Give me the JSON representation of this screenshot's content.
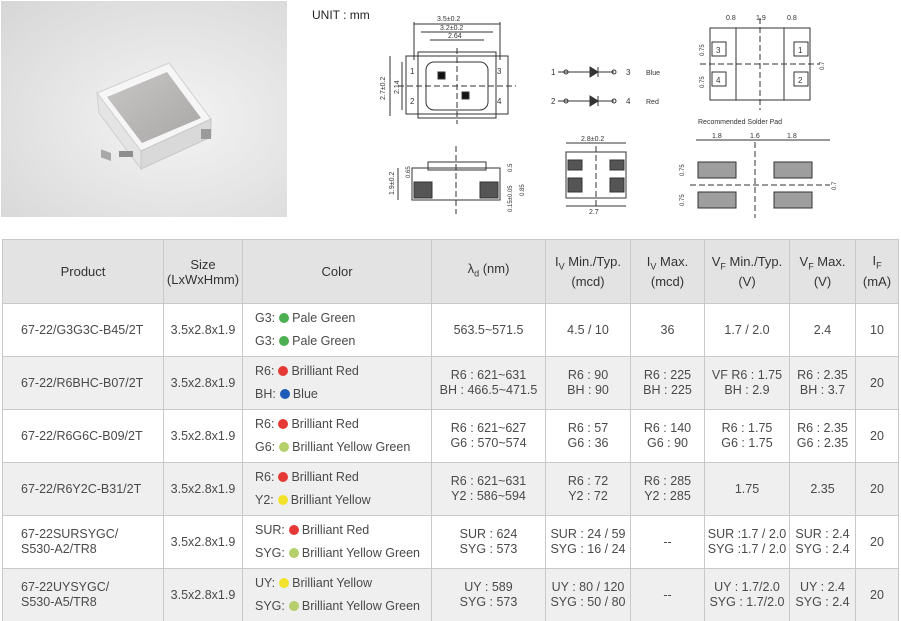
{
  "unit_label": "UNIT : mm",
  "drawing": {
    "top_dims": [
      "3.5±0.2",
      "3.2±0.2",
      "2.64"
    ],
    "left_dims": [
      "2.7±0.2",
      "2.14"
    ],
    "pad_numbers": [
      "1",
      "2",
      "3",
      "4"
    ],
    "circuit": {
      "row1": {
        "start": "1",
        "end": "3",
        "color": "Blue"
      },
      "row2": {
        "start": "2",
        "end": "4",
        "color": "Red"
      }
    },
    "side_dims": [
      "1.9±0.2",
      "0.65",
      "0.5",
      "0.15±0.05",
      "0.85"
    ],
    "front_dims": [
      "2.8±0.2",
      "2.7"
    ],
    "pad_top_dims": [
      "0.8",
      "1.9",
      "0.8"
    ],
    "pad_side_dims": [
      "0.75",
      "0.75",
      "0.7"
    ],
    "solder_title": "Recommended Solder Pad",
    "solder_dims": [
      "1.8",
      "1.6",
      "1.8"
    ],
    "solder_side_dims": [
      "0.75",
      "0.75",
      "0.7"
    ]
  },
  "table": {
    "headers": {
      "product": "Product",
      "size": "Size",
      "size_unit": "(LxWxHmm)",
      "color": "Color",
      "wavelength_symbol": "λ",
      "wavelength_sub": "d",
      "wavelength_unit": " (nm)",
      "iv_min_symbol": "I",
      "iv_min_sub": "V",
      "iv_min_label": " Min./Typ.",
      "iv_min_unit": "(mcd)",
      "iv_max_symbol": "I",
      "iv_max_sub": "V",
      "iv_max_label": " Max.",
      "iv_max_unit": "(mcd)",
      "vf_min_symbol": "V",
      "vf_min_sub": "F",
      "vf_min_label": " Min./Typ.",
      "vf_min_unit": "(V)",
      "vf_max_symbol": "V",
      "vf_max_sub": "F",
      "vf_max_label": " Max.",
      "vf_max_unit": "(V)",
      "if_symbol": "I",
      "if_sub": "F",
      "if_unit": " (mA)"
    },
    "rows": [
      {
        "product": [
          "67-22/G3G3C-B45/2T"
        ],
        "size": "3.5x2.8x1.9",
        "colors": [
          {
            "code": "G3:",
            "dot": "#4caf50",
            "name": "Pale Green"
          },
          {
            "code": "G3:",
            "dot": "#4caf50",
            "name": "Pale Green"
          }
        ],
        "wavelength": [
          "563.5~571.5"
        ],
        "iv_min_typ": [
          "4.5 / 10"
        ],
        "iv_max": [
          "36"
        ],
        "vf_min_typ": [
          "1.7 / 2.0"
        ],
        "vf_max": [
          "2.4"
        ],
        "if": "10"
      },
      {
        "product": [
          "67-22/R6BHC-B07/2T"
        ],
        "size": "3.5x2.8x1.9",
        "colors": [
          {
            "code": "R6:",
            "dot": "#e53935",
            "name": "Brilliant Red"
          },
          {
            "code": "BH:",
            "dot": "#1e5bb8",
            "name": "Blue"
          }
        ],
        "wavelength": [
          "R6 : 621~631",
          "BH : 466.5~471.5"
        ],
        "iv_min_typ": [
          "R6 : 90",
          "BH : 90"
        ],
        "iv_max": [
          "R6 : 225",
          "BH : 225"
        ],
        "vf_min_typ": [
          "VF R6 : 1.75",
          "BH : 2.9"
        ],
        "vf_max": [
          "R6 : 2.35",
          "BH : 3.7"
        ],
        "if": "20"
      },
      {
        "product": [
          "67-22/R6G6C-B09/2T"
        ],
        "size": "3.5x2.8x1.9",
        "colors": [
          {
            "code": "R6:",
            "dot": "#e53935",
            "name": "Brilliant Red"
          },
          {
            "code": "G6:",
            "dot": "#b5cf6b",
            "name": "Brilliant Yellow Green"
          }
        ],
        "wavelength": [
          "R6 : 621~627",
          "G6 : 570~574"
        ],
        "iv_min_typ": [
          "R6 : 57",
          "G6 : 36"
        ],
        "iv_max": [
          "R6 : 140",
          "G6 : 90"
        ],
        "vf_min_typ": [
          "R6 : 1.75",
          "G6 : 1.75"
        ],
        "vf_max": [
          "R6 : 2.35",
          "G6 : 2.35"
        ],
        "if": "20"
      },
      {
        "product": [
          "67-22/R6Y2C-B31/2T"
        ],
        "size": "3.5x2.8x1.9",
        "colors": [
          {
            "code": "R6:",
            "dot": "#e53935",
            "name": "Brilliant Red"
          },
          {
            "code": "Y2:",
            "dot": "#f2e22c",
            "name": "Brilliant Yellow"
          }
        ],
        "wavelength": [
          "R6 : 621~631",
          "Y2 : 586~594"
        ],
        "iv_min_typ": [
          "R6 : 72",
          "Y2 : 72"
        ],
        "iv_max": [
          "R6 : 285",
          "Y2 : 285"
        ],
        "vf_min_typ": [
          "1.75"
        ],
        "vf_max": [
          "2.35"
        ],
        "if": "20"
      },
      {
        "product": [
          "67-22SURSYGC/",
          "S530-A2/TR8"
        ],
        "size": "3.5x2.8x1.9",
        "colors": [
          {
            "code": "SUR:",
            "dot": "#e53935",
            "name": "Brilliant Red"
          },
          {
            "code": "SYG:",
            "dot": "#b5cf6b",
            "name": "Brilliant Yellow Green"
          }
        ],
        "wavelength": [
          "SUR : 624",
          "SYG : 573"
        ],
        "iv_min_typ": [
          "SUR : 24 / 59",
          "SYG : 16 / 24"
        ],
        "iv_max": [
          "--"
        ],
        "vf_min_typ": [
          "SUR :1.7 / 2.0",
          "SYG :1.7 / 2.0"
        ],
        "vf_max": [
          "SUR : 2.4",
          "SYG : 2.4"
        ],
        "if": "20"
      },
      {
        "product": [
          "67-22UYSYGC/",
          "S530-A5/TR8"
        ],
        "size": "3.5x2.8x1.9",
        "colors": [
          {
            "code": "UY:",
            "dot": "#f2e22c",
            "name": "Brilliant Yellow"
          },
          {
            "code": "SYG:",
            "dot": "#b5cf6b",
            "name": "Brilliant Yellow Green"
          }
        ],
        "wavelength": [
          "UY : 589",
          "SYG : 573"
        ],
        "iv_min_typ": [
          "UY : 80 / 120",
          "SYG : 50 / 80"
        ],
        "iv_max": [
          "--"
        ],
        "vf_min_typ": [
          "UY : 1.7/2.0",
          "SYG : 1.7/2.0"
        ],
        "vf_max": [
          "UY : 2.4",
          "SYG : 2.4"
        ],
        "if": "20"
      }
    ]
  }
}
